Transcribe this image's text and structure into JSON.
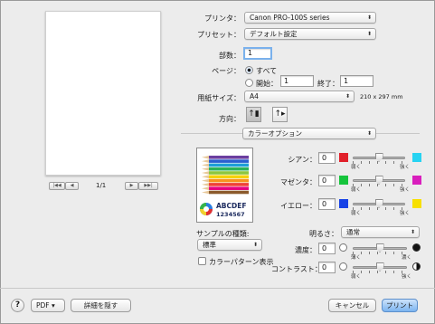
{
  "printer": {
    "label": "プリンタ：",
    "value": "Canon PRO-100S series"
  },
  "preset": {
    "label": "プリセット：",
    "value": "デフォルト設定"
  },
  "copies": {
    "label": "部数：",
    "value": "1"
  },
  "pages": {
    "label": "ページ：",
    "all": "すべて",
    "from": "開始：",
    "from_value": "1",
    "to": "終了：",
    "to_value": "1"
  },
  "paper_size": {
    "label": "用紙サイズ：",
    "value": "A4",
    "dims": "210 x 297 mm"
  },
  "orientation": {
    "label": "方向："
  },
  "section": {
    "value": "カラーオプション"
  },
  "preview": {
    "page": "1/1",
    "nav_first": "|◀◀",
    "nav_prev": "◀",
    "nav_next": "▶",
    "nav_last": "▶▶|"
  },
  "sample": {
    "line1": "ABCDEF",
    "line2": "1234567"
  },
  "colors": [
    {
      "label": "シアン：",
      "value": "0",
      "low": "弱く",
      "high": "強く",
      "left": "#e1202a",
      "right": "#27d3f2",
      "level": 0.5
    },
    {
      "label": "マゼンタ：",
      "value": "0",
      "low": "弱く",
      "high": "強く",
      "left": "#16c43c",
      "right": "#d91fbd",
      "level": 0.5
    },
    {
      "label": "イエロー：",
      "value": "0",
      "low": "弱く",
      "high": "強く",
      "left": "#1742e6",
      "right": "#f7e000",
      "level": 0.5
    }
  ],
  "sample_type": {
    "label": "サンプルの種類:",
    "value": "標準"
  },
  "color_pattern": {
    "label": "カラーパターン表示"
  },
  "brightness": {
    "label": "明るさ：",
    "value": "通常"
  },
  "density": {
    "label": "濃度：",
    "value": "0",
    "low": "薄く",
    "high": "濃く",
    "level": 0.5
  },
  "contrast": {
    "label": "コントラスト：",
    "value": "0",
    "low": "弱く",
    "high": "強く",
    "level": 0.5
  },
  "footer": {
    "help": "?",
    "pdf": "PDF",
    "pdf_arrow": "▾",
    "details": "詳細を隠す",
    "cancel": "キャンセル",
    "print": "プリント"
  },
  "popup_arrow": "⬍"
}
